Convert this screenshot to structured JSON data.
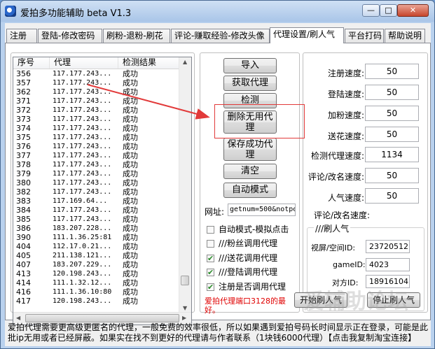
{
  "window": {
    "title": "爱拍多功能辅助 beta V1.3",
    "min_glyph": "—",
    "max_glyph": "□",
    "close_glyph": "✕"
  },
  "tabs": [
    {
      "label": "注册"
    },
    {
      "label": "登陆-修改密码"
    },
    {
      "label": "刷粉-退粉-刷花"
    },
    {
      "label": "评论-赚取经验-修改头像"
    },
    {
      "label": "代理设置/刷人气"
    },
    {
      "label": "平台打码"
    },
    {
      "label": "帮助说明"
    }
  ],
  "proxy_list": {
    "columns": [
      "序号",
      "代理",
      "检测结果"
    ],
    "rows": [
      [
        "356",
        "117.177.243...",
        "成功"
      ],
      [
        "357",
        "117.177.243...",
        "成功"
      ],
      [
        "362",
        "117.177.243...",
        "成功"
      ],
      [
        "371",
        "117.177.243...",
        "成功"
      ],
      [
        "372",
        "117.177.243...",
        "成功"
      ],
      [
        "373",
        "117.177.243...",
        "成功"
      ],
      [
        "374",
        "117.177.243...",
        "成功"
      ],
      [
        "375",
        "117.177.243...",
        "成功"
      ],
      [
        "376",
        "117.177.243...",
        "成功"
      ],
      [
        "377",
        "117.177.243...",
        "成功"
      ],
      [
        "378",
        "117.177.243...",
        "成功"
      ],
      [
        "379",
        "117.177.243...",
        "成功"
      ],
      [
        "380",
        "117.177.243...",
        "成功"
      ],
      [
        "382",
        "117.177.243...",
        "成功"
      ],
      [
        "383",
        "117.169.64...",
        "成功"
      ],
      [
        "384",
        "117.177.243...",
        "成功"
      ],
      [
        "385",
        "117.177.243...",
        "成功"
      ],
      [
        "386",
        "183.207.228...",
        "成功"
      ],
      [
        "390",
        "111.1.36.25:81",
        "成功"
      ],
      [
        "404",
        "112.17.0.21...",
        "成功"
      ],
      [
        "405",
        "211.138.121...",
        "成功"
      ],
      [
        "407",
        "183.207.229...",
        "成功"
      ],
      [
        "413",
        "120.198.243...",
        "成功"
      ],
      [
        "414",
        "111.1.32.12...",
        "成功"
      ],
      [
        "416",
        "111.1.36.10:80",
        "成功"
      ],
      [
        "417",
        "120.198.243...",
        "成功"
      ]
    ]
  },
  "buttons": {
    "import": "导入",
    "fetch_proxy": "获取代理",
    "detect": "检测",
    "delete_unused": "删除无用代理",
    "save_success": "保存成功代理",
    "clear": "清空",
    "auto_mode": "自动模式",
    "start_popularity": "开始刷人气",
    "stop_popularity": "停止刷人气"
  },
  "url": {
    "label": "网址:",
    "value": "getnum=500&notpo"
  },
  "checkboxes": [
    {
      "label": "自动模式-模拟点击",
      "checked": false
    },
    {
      "label": "///粉丝调用代理",
      "checked": false
    },
    {
      "label": "///送花调用代理",
      "checked": true
    },
    {
      "label": "///登陆调用代理",
      "checked": true
    },
    {
      "label": "注册是否调用代理",
      "checked": true
    }
  ],
  "red_note": "爱拍代理端口3128的最好。",
  "speeds": [
    {
      "label": "注册速度:",
      "value": "50"
    },
    {
      "label": "登陆速度:",
      "value": "50"
    },
    {
      "label": "加粉速度:",
      "value": "50"
    },
    {
      "label": "送花速度:",
      "value": "50"
    },
    {
      "label": "检测代理速度:",
      "value": "1134"
    },
    {
      "label": "评论/改名速度:",
      "value": "50"
    },
    {
      "label": "人气速度:",
      "value": "50"
    }
  ],
  "comment_rename_label": "评论/改名速度:",
  "popularity": {
    "group_title": "///刷人气",
    "video_id_label": "视屏/空间ID:",
    "video_id": "23720512",
    "game_id_label": "gameID:",
    "game_id": "4023",
    "target_id_label": "对方ID:",
    "target_id": "18916104"
  },
  "status_text": "爱拍代理需要更高级更匿名的代理，一般免费的效率很低，所以如果遇到爱拍号码长时间显示正在登录，可能是此批ip无用或者已经屏蔽。如果实在找不到更好的代理请与作者联系（1块钱6000代理）【点击我复制淘宝连接】",
  "watermark": "爱辅助论坛"
}
